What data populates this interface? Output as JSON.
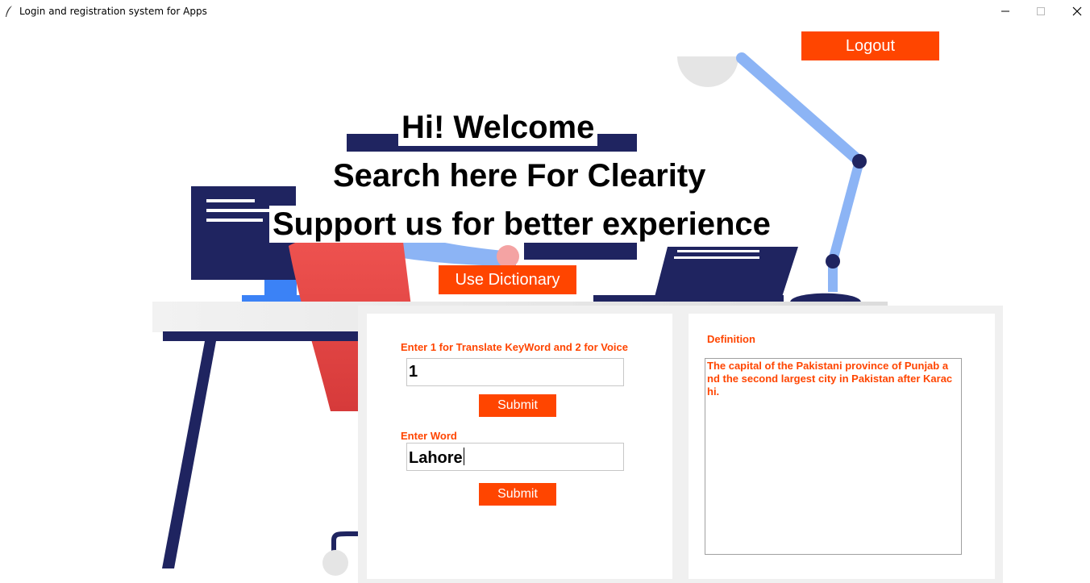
{
  "window": {
    "title": "Login and registration system for Apps"
  },
  "header": {
    "logout_label": "Logout"
  },
  "welcome": {
    "line1": "Hi! Welcome",
    "line2": "Search here For Clearity",
    "line3": "Support us for better experience",
    "dictionary_button": "Use Dictionary"
  },
  "dictionary": {
    "mode_label": "Enter 1 for Translate KeyWord and 2 for Voice",
    "mode_value": "1",
    "mode_submit": "Submit",
    "word_label": "Enter Word",
    "word_value": "Lahore",
    "word_submit": "Submit",
    "definition_label": "Definition",
    "definition_lines": [
      "The capital of the Pakistani province of Punjab a",
      "nd the second largest city in Pakistan after Karac",
      "hi."
    ]
  },
  "colors": {
    "accent": "#ff4500",
    "illustration_navy": "#1f2460",
    "illustration_red": "#e84545",
    "illustration_blue": "#8cb4f5"
  }
}
